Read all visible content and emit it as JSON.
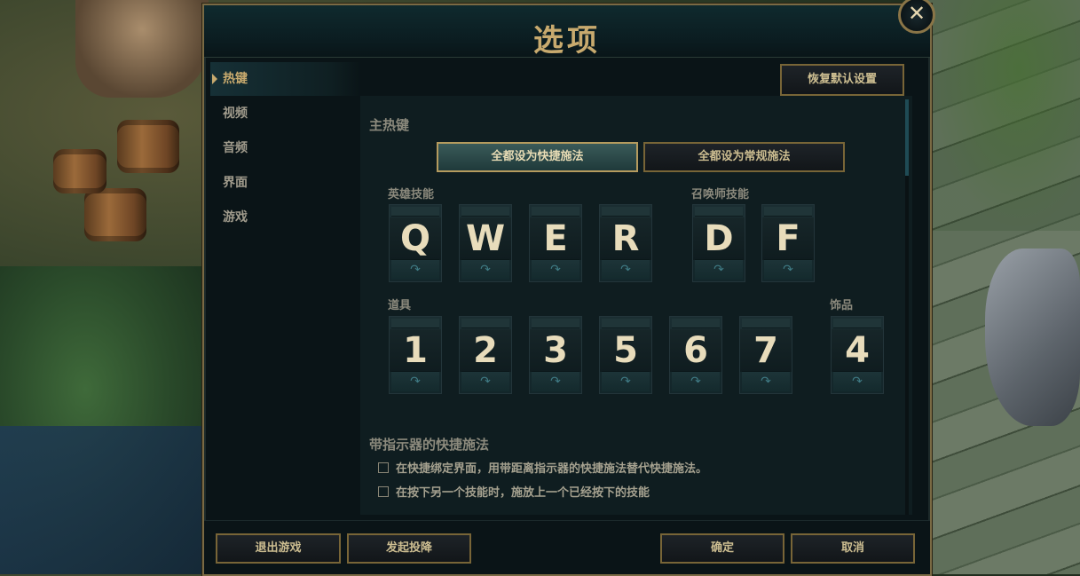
{
  "window": {
    "title": "选项"
  },
  "sidebar": {
    "items": [
      {
        "label": "热键",
        "active": true
      },
      {
        "label": "视频",
        "active": false
      },
      {
        "label": "音频",
        "active": false
      },
      {
        "label": "界面",
        "active": false
      },
      {
        "label": "游戏",
        "active": false
      }
    ]
  },
  "toolbar": {
    "restore_defaults": "恢复默认设置"
  },
  "main_hotkeys": {
    "section_title": "主热键",
    "set_all_quick": "全都设为快捷施法",
    "set_all_normal": "全都设为常规施法",
    "champion_abilities_label": "英雄技能",
    "summoner_spells_label": "召唤师技能",
    "items_label": "道具",
    "trinket_label": "饰品",
    "ability_keys": [
      "Q",
      "W",
      "E",
      "R"
    ],
    "summoner_keys": [
      "D",
      "F"
    ],
    "item_keys": [
      "1",
      "2",
      "3",
      "5",
      "6",
      "7"
    ],
    "trinket_key": "4",
    "toggle_glyph": "↷"
  },
  "indicator_section": {
    "title": "带指示器的快捷施法",
    "options": [
      {
        "label": "在快捷绑定界面，用带距离指示器的快捷施法替代快捷施法。",
        "checked": false
      },
      {
        "label": "在按下另一个技能时，施放上一个已经按下的技能",
        "checked": false
      }
    ]
  },
  "footer": {
    "exit_game": "退出游戏",
    "surrender": "发起投降",
    "ok": "确定",
    "cancel": "取消"
  },
  "close_icon": "close-icon",
  "colors": {
    "gold": "#c8aa6e",
    "panel": "#0f1d20",
    "teal_button": "#3a5a59"
  }
}
